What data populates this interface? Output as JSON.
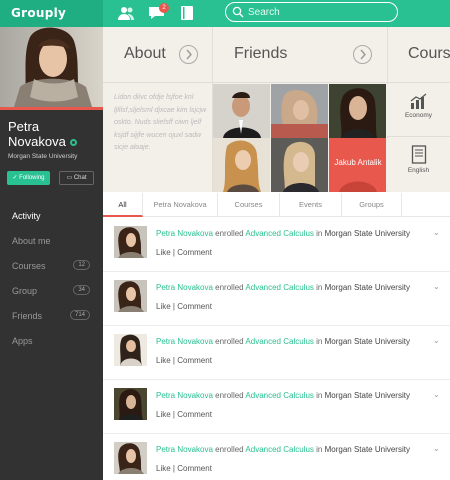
{
  "app": {
    "logo": "Grouply",
    "notification_count": "2"
  },
  "search": {
    "placeholder": "Search"
  },
  "profile": {
    "first_name": "Petra",
    "last_name": "Novakova",
    "university": "Morgan State University",
    "follow_label": "Following",
    "chat_label": "Chat"
  },
  "sidebar": {
    "items": [
      {
        "label": "Activity",
        "count": ""
      },
      {
        "label": "About me",
        "count": ""
      },
      {
        "label": "Courses",
        "count": "12"
      },
      {
        "label": "Group",
        "count": "34"
      },
      {
        "label": "Friends",
        "count": "714"
      },
      {
        "label": "Apps",
        "count": ""
      }
    ]
  },
  "tiles": {
    "about_title": "About",
    "about_text": "Lidon diivc ofdje lsjfoe knl ljfilsf,sljelsml djxcae kim lsjcjw oskto. Nuds sliefsff ciwn ljelf ksjdf sijjfe wucen ojuxl sadw sicje aloaje.",
    "friends_title": "Friends",
    "friend_overlay": "Jakub Antalik",
    "courses_title": "Courses",
    "courses": [
      {
        "label": "Economy",
        "icon": "chart-icon"
      },
      {
        "label": "English",
        "icon": "book-icon"
      }
    ]
  },
  "tabs": [
    "All",
    "Petra Novakova",
    "Courses",
    "Events",
    "Groups"
  ],
  "feed": {
    "actor": "Petra Novakova",
    "verb": "enrolled",
    "object": "Advanced Calculus",
    "preposition": "in",
    "place": "Morgan State University",
    "like": "Like",
    "sep": "|",
    "comment": "Comment",
    "expand_icon": "chevron-down-icon"
  },
  "colors": {
    "accent": "#29c191",
    "accent_dark": "#1fae82",
    "highlight": "#e8584c",
    "sidebar": "#323232",
    "tile_bg": "#f3efe9"
  }
}
